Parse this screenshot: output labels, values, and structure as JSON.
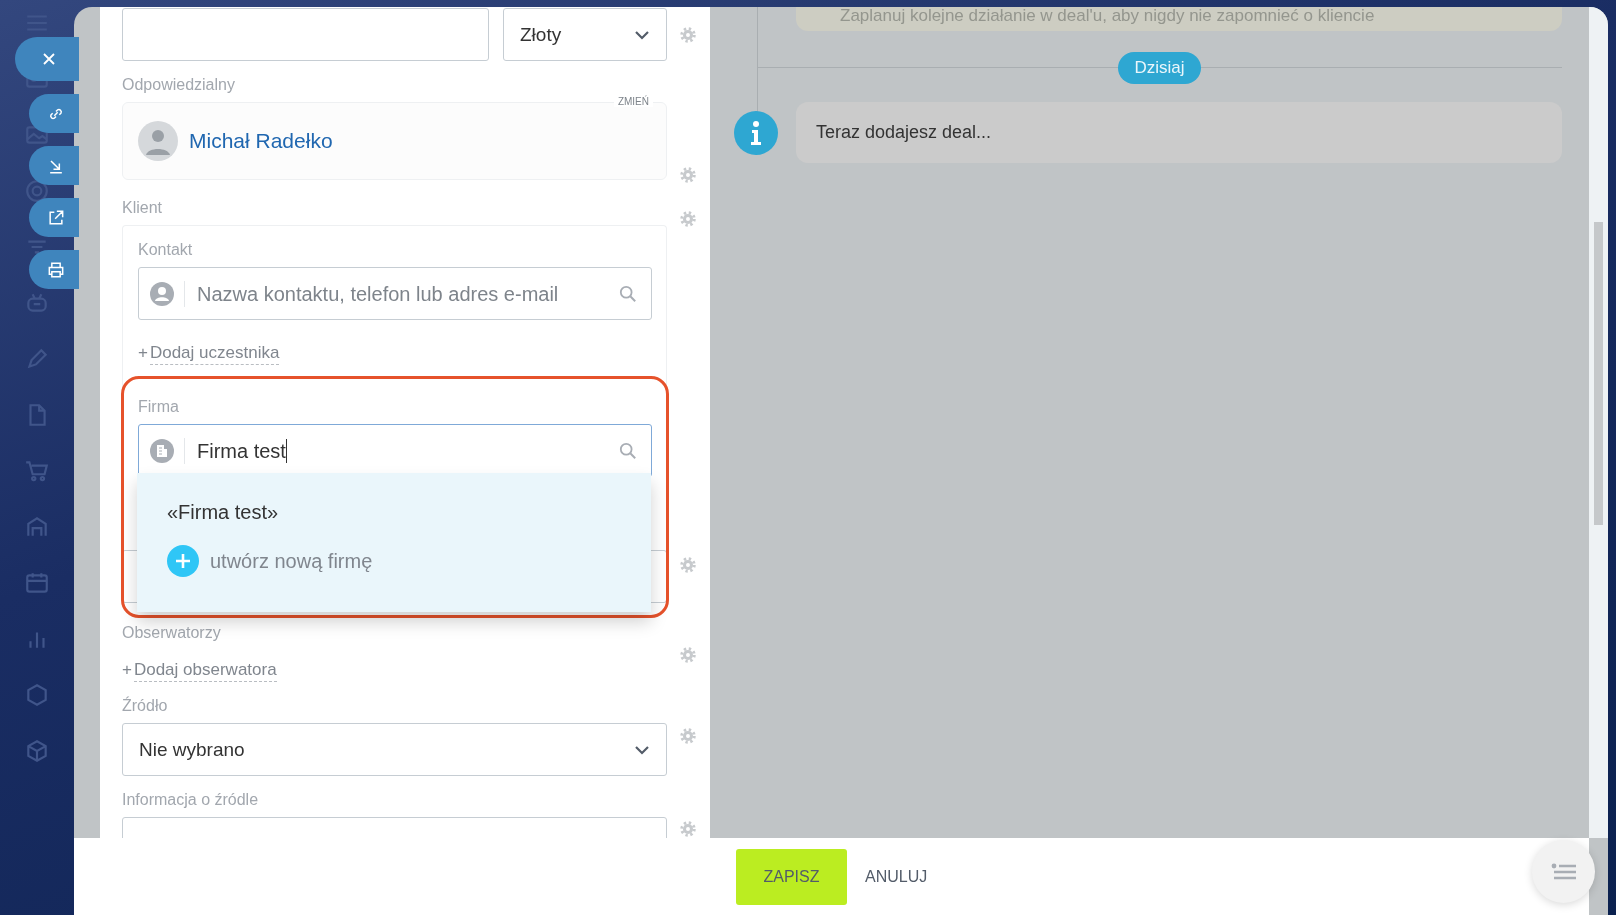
{
  "form": {
    "currency": {
      "value": "Złoty"
    },
    "responsible": {
      "label": "Odpowiedzialny",
      "action": "ZMIEŃ",
      "name": "Michał Radełko"
    },
    "client": {
      "label": "Klient",
      "contact": {
        "label": "Kontakt",
        "placeholder": "Nazwa kontaktu, telefon lub adres e-mail"
      },
      "add_participant": {
        "sign": "+",
        "label": "Dodaj uczestnika"
      },
      "company": {
        "label": "Firma",
        "value": "Firma test"
      }
    },
    "company_suggestions": [
      {
        "kind": "match",
        "label": "«Firma test»"
      },
      {
        "kind": "create",
        "label": "utwórz nową firmę"
      }
    ],
    "observers": {
      "label": "Obserwatorzy",
      "add": {
        "sign": "+",
        "label": "Dodaj obserwatora"
      }
    },
    "source": {
      "label": "Źródło",
      "value": "Nie wybrano"
    },
    "source_info": {
      "label": "Informacja o źródle"
    }
  },
  "timeline": {
    "hint": "Zaplanuj kolejne działanie w deal'u, aby nigdy nie zapomnieć o kliencie",
    "date_badge": "Dzisiaj",
    "entry": "Teraz dodajesz deal..."
  },
  "footer": {
    "buttons": [
      {
        "kind": "primary",
        "label": "ZAPISZ"
      },
      {
        "kind": "link",
        "label": "ANULUJ"
      }
    ]
  }
}
